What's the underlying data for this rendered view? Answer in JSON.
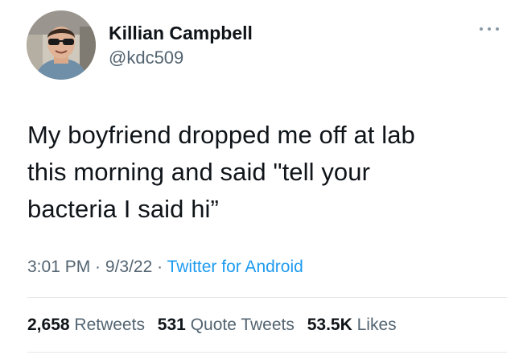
{
  "author": {
    "name": "Killian Campbell",
    "handle": "@kdc509"
  },
  "icons": {
    "more": "more-horizontal-icon",
    "avatar": "profile-photo"
  },
  "tweet": {
    "text": "My boyfriend dropped me off at lab\nthis morning and said \"tell your\nbacteria I said hi”"
  },
  "meta": {
    "time": "3:01 PM",
    "separator1": " · ",
    "date": "9/3/22",
    "separator2": " · ",
    "source": "Twitter for Android"
  },
  "stats": {
    "retweets_count": "2,658",
    "retweets_label": "Retweets",
    "quotes_count": "531",
    "quotes_label": "Quote Tweets",
    "likes_count": "53.5K",
    "likes_label": "Likes"
  },
  "colors": {
    "text": "#0f1419",
    "secondary": "#536471",
    "link": "#1d9bf0",
    "divider": "#e3e7ea"
  }
}
